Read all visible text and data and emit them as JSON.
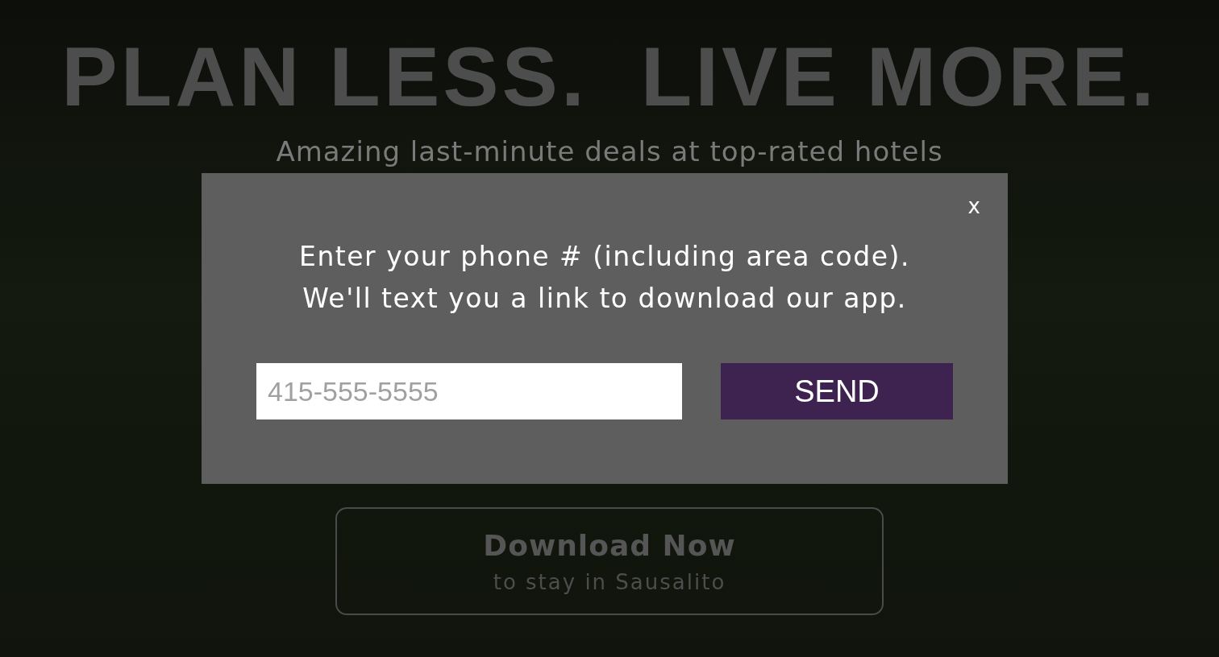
{
  "hero": {
    "heading": "PLAN LESS.  LIVE MORE.",
    "subtitle": "Amazing last-minute deals at top-rated hotels"
  },
  "download_button": {
    "title": "Download Now",
    "subtitle": "to stay in Sausalito"
  },
  "modal": {
    "close": "x",
    "message_lines": [
      "Enter your phone # (including area code).",
      "We'll text you a link to download our app."
    ],
    "phone_field": {
      "placeholder": "415-555-5555"
    },
    "send_button": "SEND"
  }
}
